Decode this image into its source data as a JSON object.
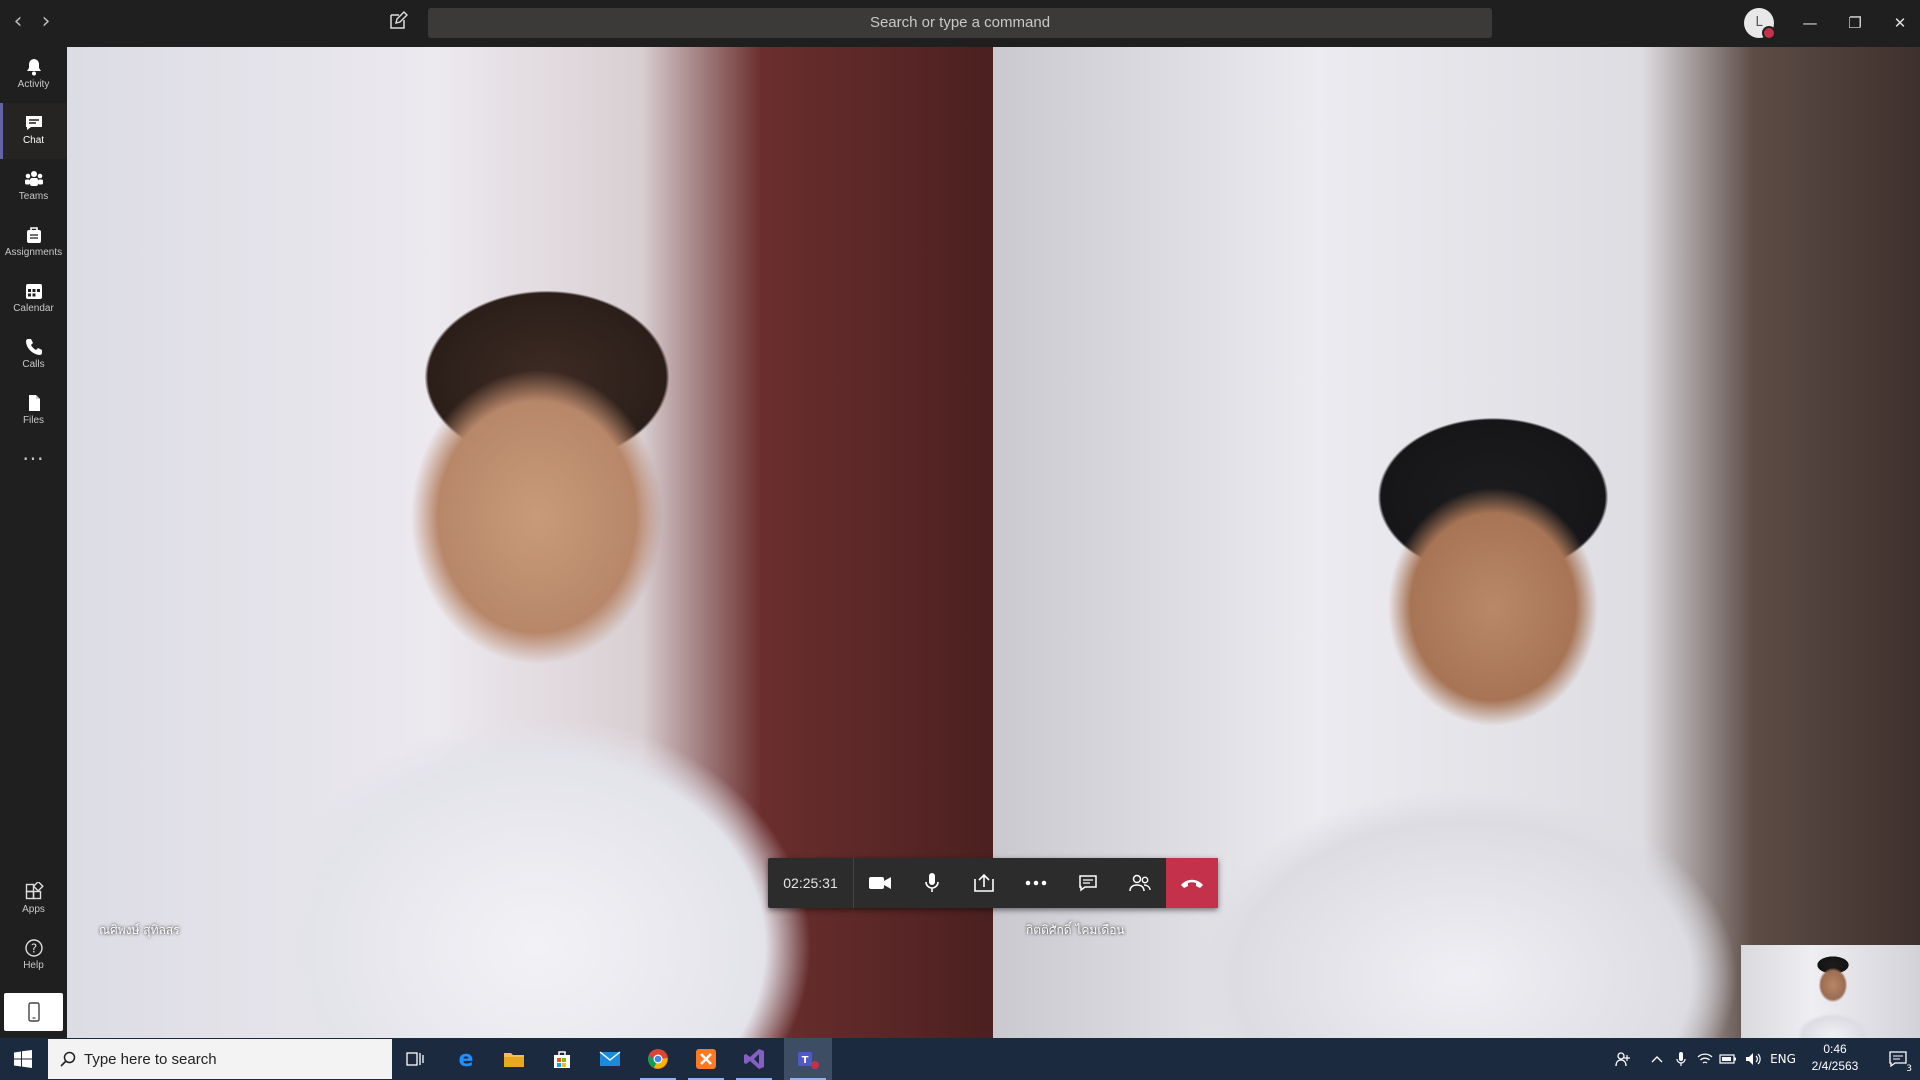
{
  "titlebar": {
    "search_placeholder": "Search or type a command",
    "avatar_initial": "L",
    "presence_color": "#c4314b"
  },
  "rail": {
    "items": [
      {
        "label": "Activity",
        "icon": "bell-icon"
      },
      {
        "label": "Chat",
        "icon": "chat-icon",
        "active": true
      },
      {
        "label": "Teams",
        "icon": "teams-icon"
      },
      {
        "label": "Assignments",
        "icon": "assignments-icon"
      },
      {
        "label": "Calendar",
        "icon": "calendar-icon"
      },
      {
        "label": "Calls",
        "icon": "phone-icon"
      },
      {
        "label": "Files",
        "icon": "files-icon"
      },
      {
        "label": "Apps",
        "icon": "apps-icon"
      },
      {
        "label": "Help",
        "icon": "help-icon"
      }
    ],
    "more_label": "..."
  },
  "call": {
    "participants": [
      {
        "name": "ณศิพงษ์ สุทิลสร"
      },
      {
        "name": "กิตติศักดิ์ ไคมเดือน"
      }
    ],
    "timer": "02:25:31",
    "hangup_color": "#c4314b"
  },
  "taskbar": {
    "search_placeholder": "Type here to search",
    "language": "ENG",
    "time": "0:46",
    "date": "2/4/2563",
    "notification_count": "3",
    "apps": [
      "task-view-icon",
      "edge-icon",
      "file-explorer-icon",
      "store-icon",
      "mail-icon",
      "chrome-icon",
      "xampp-icon",
      "visual-studio-icon",
      "teams-taskbar-icon"
    ]
  },
  "colors": {
    "accent": "#6264a7",
    "taskbar": "#1b2a3f"
  }
}
